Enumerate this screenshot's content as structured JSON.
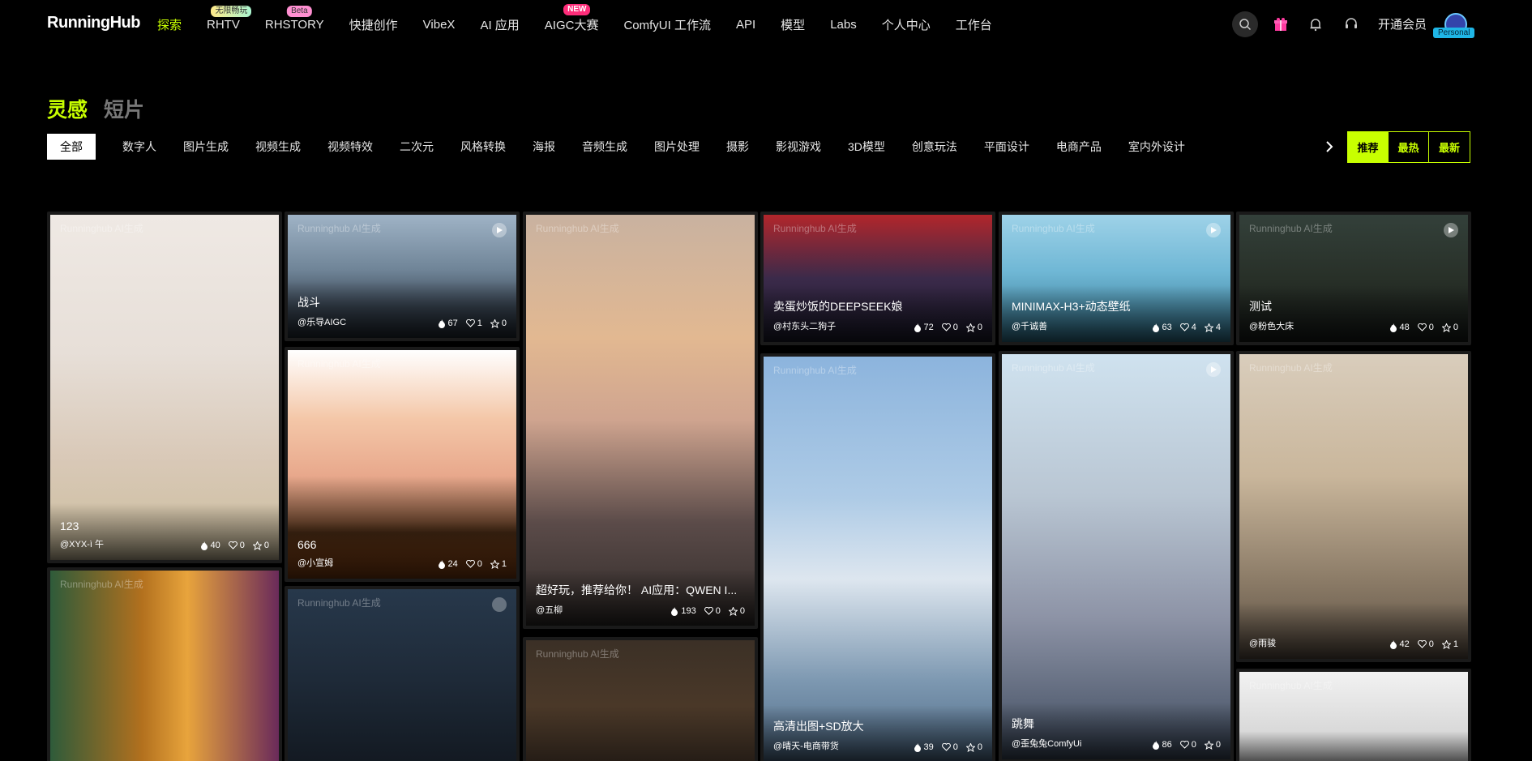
{
  "nav": {
    "logo": "RunningHub",
    "items": [
      {
        "label": "探索",
        "active": true
      },
      {
        "label": "RHTV",
        "badge": "无限畅玩"
      },
      {
        "label": "RHSTORY",
        "badge": "Beta"
      },
      {
        "label": "快捷创作"
      },
      {
        "label": "VibeX"
      },
      {
        "label": "AI 应用"
      },
      {
        "label": "AIGC大赛",
        "badge": "NEW"
      },
      {
        "label": "ComfyUI 工作流"
      },
      {
        "label": "API"
      },
      {
        "label": "模型"
      },
      {
        "label": "Labs"
      },
      {
        "label": "个人中心"
      },
      {
        "label": "工作台"
      }
    ],
    "vip_label": "开通会员",
    "personal_label": "Personal"
  },
  "section_tabs": [
    {
      "label": "灵感",
      "active": true
    },
    {
      "label": "短片"
    }
  ],
  "categories": [
    "全部",
    "数字人",
    "图片生成",
    "视频生成",
    "视频特效",
    "二次元",
    "风格转换",
    "海报",
    "音频生成",
    "图片处理",
    "摄影",
    "影视游戏",
    "3D模型",
    "创意玩法",
    "平面设计",
    "电商产品",
    "室内外设计"
  ],
  "sort_options": [
    {
      "label": "推荐",
      "active": true
    },
    {
      "label": "最热"
    },
    {
      "label": "最新"
    }
  ],
  "watermark": "Runninghub AI生成",
  "cards": [
    {
      "title": "123",
      "author": "@XYX-ì 午",
      "likes": "40",
      "comments": "0",
      "stars": "0"
    },
    {
      "title": "战斗",
      "author": "@乐导AIGC",
      "likes": "67",
      "comments": "1",
      "stars": "0",
      "video": true
    },
    {
      "title": "666",
      "author": "@小宣姆",
      "likes": "24",
      "comments": "0",
      "stars": "1"
    },
    {
      "title": "",
      "author": "",
      "likes": "",
      "comments": "",
      "stars": "",
      "multi": true
    },
    {
      "title": "超好玩，推荐给你！ AI应用：QWEN I...",
      "author": "@五柳",
      "likes": "193",
      "comments": "0",
      "stars": "0"
    },
    {
      "title": "",
      "author": "",
      "likes": "",
      "comments": "",
      "stars": ""
    },
    {
      "title": "卖蛋炒饭的DEEPSEEK娘",
      "author": "@村东头二狗子",
      "likes": "72",
      "comments": "0",
      "stars": "0"
    },
    {
      "title": "高清出图+SD放大",
      "author": "@晴天-电商带货",
      "likes": "39",
      "comments": "0",
      "stars": "0"
    },
    {
      "title": "MINIMAX-H3+动态壁纸",
      "author": "@千诚善",
      "likes": "63",
      "comments": "4",
      "stars": "4",
      "video": true
    },
    {
      "title": "跳舞",
      "author": "@歪兔兔ComfyUi",
      "likes": "86",
      "comments": "0",
      "stars": "0",
      "video": true
    },
    {
      "title": "测试",
      "author": "@粉色大床",
      "likes": "48",
      "comments": "0",
      "stars": "0",
      "video": true
    },
    {
      "title": "",
      "author": "@雨骏",
      "likes": "42",
      "comments": "0",
      "stars": "1"
    },
    {
      "title": "",
      "author": "",
      "likes": "",
      "comments": "",
      "stars": ""
    },
    {
      "title": "",
      "author": "",
      "likes": "",
      "comments": "",
      "stars": ""
    }
  ]
}
